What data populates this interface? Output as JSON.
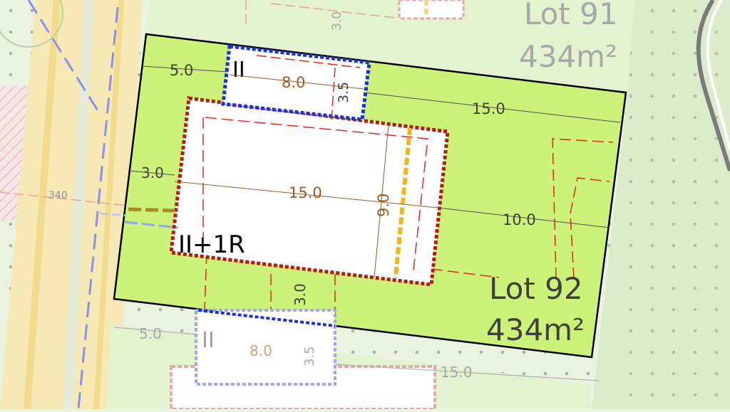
{
  "colors": {
    "background": "#e9f3df",
    "lot_fill": "#ccf27a",
    "lot_outline": "#000000",
    "building_zone": "#b31b12",
    "garage_zone": "#1c2fd8",
    "setback_line": "#e02a1a",
    "dimension_text_building": "#a0581e",
    "dimension_text_lot": "#404040",
    "road_band": "#f5e7a8",
    "service_line_blue": "#8b8ff0",
    "marker_yellow": "#f0b71a"
  },
  "lots": {
    "lot_91": {
      "name": "Lot 91",
      "area": "434m²"
    },
    "lot_92": {
      "name": "Lot 92",
      "area": "434m²"
    }
  },
  "zones": {
    "garage_main_label": "II",
    "garage_lower_label": "II",
    "house_label": "II+1R"
  },
  "dimensions": {
    "top_left_5": "5.0",
    "garage_width": "8.0",
    "garage_depth": "3.5",
    "lot_side_15": "15.0",
    "front_setback": "3.0",
    "house_width": "15.0",
    "house_depth": "9.0",
    "rear_10": "10.0",
    "gap_3": "3.0",
    "lower_5": "5.0",
    "lower_garage_width": "8.0",
    "lower_garage_depth": "3.5",
    "lower_15": "15.0",
    "upper_3": "3.0",
    "contour_340": "340"
  }
}
